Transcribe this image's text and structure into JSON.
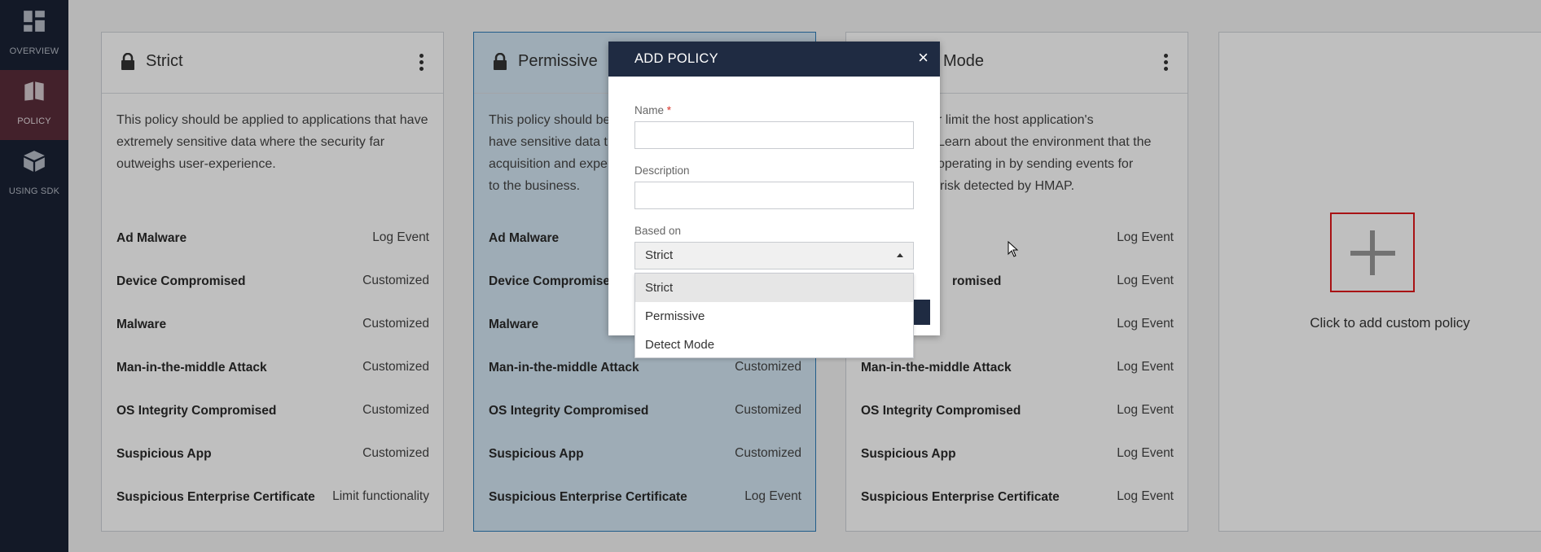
{
  "sidebar": {
    "items": [
      {
        "label": "OVERVIEW",
        "icon": "dashboard-icon"
      },
      {
        "label": "POLICY",
        "icon": "policy-book-icon",
        "active": true
      },
      {
        "label": "USING SDK",
        "icon": "sdk-cube-icon"
      }
    ]
  },
  "cards": [
    {
      "title": "Strict",
      "description": "This policy should be applied to applications that have extremely sensitive data where the security far outweighs user-experience.",
      "rules": [
        {
          "name": "Ad Malware",
          "value": "Log Event"
        },
        {
          "name": "Device Compromised",
          "value": "Customized"
        },
        {
          "name": "Malware",
          "value": "Customized"
        },
        {
          "name": "Man-in-the-middle Attack",
          "value": "Customized"
        },
        {
          "name": "OS Integrity Compromised",
          "value": "Customized"
        },
        {
          "name": "Suspicious App",
          "value": "Customized"
        },
        {
          "name": "Suspicious Enterprise Certificate",
          "value": "Limit functionality"
        }
      ]
    },
    {
      "title": "Permissive",
      "description": "This policy should be have sensitive data t acquisition and expe to the business.",
      "rules": [
        {
          "name": "Ad Malware",
          "value": ""
        },
        {
          "name": "Device Compromise",
          "value": ""
        },
        {
          "name": "Malware",
          "value": ""
        },
        {
          "name": "Man-in-the-middle Attack",
          "value": "Customized"
        },
        {
          "name": "OS Integrity Compromised",
          "value": "Customized"
        },
        {
          "name": "Suspicious App",
          "value": "Customized"
        },
        {
          "name": "Suspicious Enterprise Certificate",
          "value": "Log Event"
        }
      ]
    },
    {
      "title": "Mode",
      "description_lines": [
        "r limit the host application's",
        "Learn about the environment that the",
        "operating in by sending events for",
        "risk detected by HMAP."
      ],
      "rules": [
        {
          "name": "",
          "value": "Log Event"
        },
        {
          "name": "romised",
          "value": "Log Event"
        },
        {
          "name": "",
          "value": "Log Event"
        },
        {
          "name": "Man-in-the-middle Attack",
          "value": "Log Event"
        },
        {
          "name": "OS Integrity Compromised",
          "value": "Log Event"
        },
        {
          "name": "Suspicious App",
          "value": "Log Event"
        },
        {
          "name": "Suspicious Enterprise Certificate",
          "value": "Log Event"
        }
      ]
    }
  ],
  "add_card": {
    "label": "Click to add custom policy"
  },
  "modal": {
    "title": "ADD POLICY",
    "close": "×",
    "name_label": "Name",
    "required_mark": "*",
    "description_label": "Description",
    "based_on_label": "Based on",
    "based_on_value": "Strict",
    "options": [
      "Strict",
      "Permissive",
      "Detect Mode"
    ]
  },
  "colors": {
    "sidebar_bg": "#1a2234",
    "sidebar_active": "#5a2c3a",
    "modal_header": "#1f2b42",
    "selected_card": "#d3e6f3",
    "highlight_border": "#e0191b"
  }
}
